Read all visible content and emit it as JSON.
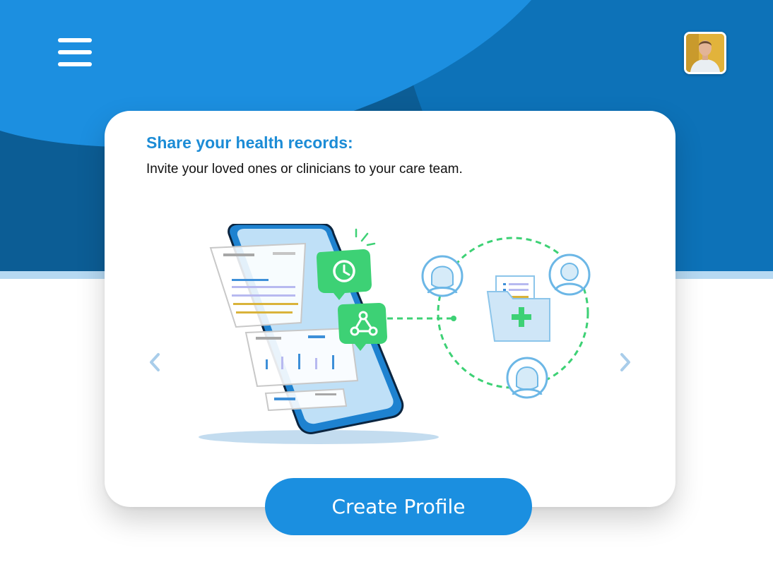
{
  "header": {
    "menu_icon": "hamburger-menu-icon",
    "avatar_icon": "user-avatar-photo"
  },
  "card": {
    "title": "Share your health records:",
    "subtitle": "Invite your loved ones or clinicians to your care team.",
    "illustration_icons": [
      "smartphone-icon",
      "clock-badge-icon",
      "share-badge-icon",
      "medical-folder-icon",
      "care-team-person-icon"
    ]
  },
  "carousel": {
    "prev_icon": "chevron-left-icon",
    "next_icon": "chevron-right-icon"
  },
  "cta": {
    "label": "Create Profile"
  },
  "colors": {
    "primary_blue": "#1b8fe0",
    "dark_blue": "#0c5d95",
    "accent_green": "#3dd175",
    "title_blue": "#1c8cd6"
  }
}
